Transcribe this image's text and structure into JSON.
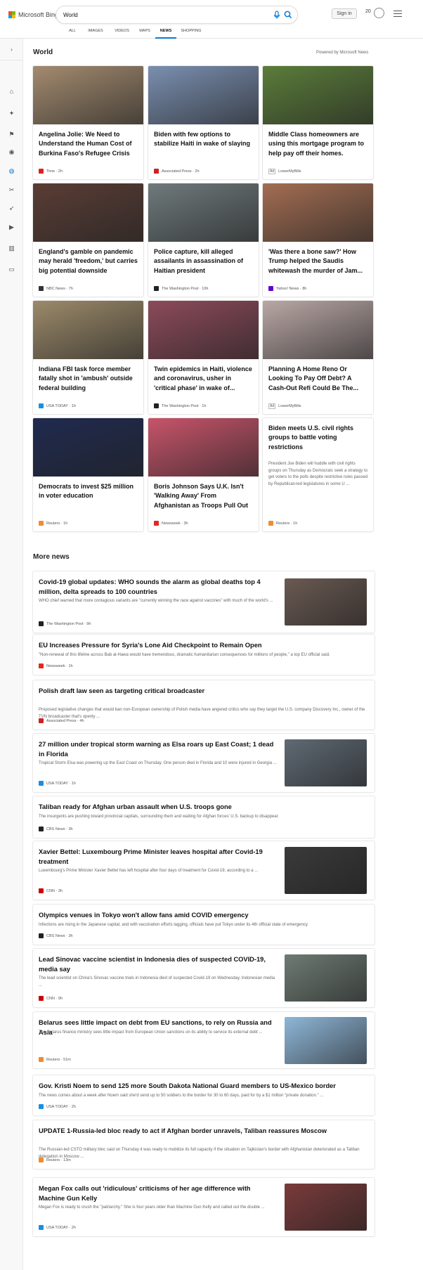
{
  "header": {
    "logo_text": "Microsoft Bing",
    "search_value": "World",
    "sign_in": "Sign in",
    "rewards_points": "20"
  },
  "tabs": [
    "ALL",
    "IMAGES",
    "VIDEOS",
    "MAPS",
    "NEWS",
    "SHOPPING"
  ],
  "active_tab": "NEWS",
  "sidebar_icons": [
    "chevron-right-icon",
    "home-icon",
    "sparkle-icon",
    "flag-icon",
    "location-icon",
    "globe-icon",
    "science-icon",
    "rocket-icon",
    "video-icon",
    "building-icon",
    "card-icon"
  ],
  "world": {
    "title": "World",
    "powered_by": "Powered by Microsoft News",
    "cards": [
      {
        "title": "Angelina Jolie: We Need to Understand the Human Cost of Burkina Faso's Refugee Crisis",
        "source": "Time",
        "age": "2h",
        "ad": "",
        "snippet": "",
        "image_color": "#a38b6f"
      },
      {
        "title": "Biden with few options to stabilize Haiti in wake of slaying",
        "source": "Associated Press",
        "age": "2h",
        "ad": "",
        "snippet": "",
        "image_color": "#7a8fb0"
      },
      {
        "title": "Middle Class homeowners are using this mortgage program to help pay off their homes.",
        "source": "LowerMyBills",
        "age": "",
        "ad": "Ad",
        "snippet": "",
        "image_color": "#5b7d3a"
      },
      {
        "title": "England's gamble on pandemic may herald 'freedom,' but carries big potential downside",
        "source": "NBC News",
        "age": "7h",
        "ad": "",
        "snippet": "",
        "image_color": "#5a3d35"
      },
      {
        "title": "Police capture, kill alleged assailants in assassination of Haitian president",
        "source": "The Washington Post",
        "age": "10h",
        "ad": "",
        "snippet": "",
        "image_color": "#6f7a7c"
      },
      {
        "title": "'Was there a bone saw?' How Trump helped the Saudis whitewash the murder of Jam...",
        "source": "Yahoo! News",
        "age": "8h",
        "ad": "",
        "snippet": "",
        "image_color": "#a36d52"
      },
      {
        "title": "Indiana FBI task force member fatally shot in 'ambush' outside federal building",
        "source": "USA TODAY",
        "age": "1h",
        "ad": "",
        "snippet": "",
        "image_color": "#9c8a6a"
      },
      {
        "title": "Twin epidemics in Haiti, violence and coronavirus, usher in 'critical phase' in wake of...",
        "source": "The Washington Post",
        "age": "1h",
        "ad": "",
        "snippet": "",
        "image_color": "#8c4a5a"
      },
      {
        "title": "Planning A Home Reno Or Looking To Pay Off Debt? A Cash-Out Refi Could Be The...",
        "source": "LowerMyBills",
        "age": "",
        "ad": "Ad",
        "snippet": "",
        "image_color": "#b9a7a5"
      },
      {
        "title": "Democrats to invest $25 million in voter education",
        "source": "Reuters",
        "age": "1h",
        "ad": "",
        "snippet": "",
        "image_color": "#1f2a4f"
      },
      {
        "title": "Boris Johnson Says U.K. Isn't 'Walking Away' From Afghanistan as Troops Pull Out",
        "source": "Newsweek",
        "age": "3h",
        "ad": "",
        "snippet": "",
        "image_color": "#c7546a"
      },
      {
        "title": "Biden meets U.S. civil rights groups to battle voting restrictions",
        "source": "Reuters",
        "age": "1h",
        "ad": "",
        "snippet": "President Joe Biden will huddle with civil rights groups on Thursday as Democrats seek a strategy to get voters to the polls despite restrictive rules passed by Republican-led legislatures in some U ...",
        "image_color": ""
      }
    ]
  },
  "more_news": {
    "title": "More news",
    "items": [
      {
        "title": "Covid-19 global updates: WHO sounds the alarm as global deaths top 4 million, delta spreads to 100 countries",
        "snippet": "WHO chief warned that more contagious variants are \"currently winning the race against vaccines\" with much of the world's ...",
        "source": "The Washington Post",
        "age": "9h",
        "image_color": "#6a5a52"
      },
      {
        "title": "EU Increases Pressure for Syria's Lone Aid Checkpoint to Remain Open",
        "snippet": "\"Non-renewal of this lifeline across Bab al-Hawa would have tremendous, dramatic humanitarian consequences for millions of people,\" a top EU official said.",
        "source": "Newsweek",
        "age": "1h",
        "image_color": ""
      },
      {
        "title": "Polish draft law seen as targeting critical broadcaster",
        "snippet": "Proposed legislative changes that would ban non-European ownership of Polish media have angered critics who say they target the U.S. company Discovery Inc., owner of the TVN broadcaster that's openly ...",
        "source": "Associated Press",
        "age": "4h",
        "image_color": ""
      },
      {
        "title": "27 million under tropical storm warning as Elsa roars up East Coast; 1 dead in Florida",
        "snippet": "Tropical Storm Elsa was powering up the East Coast on Thursday. One person died in Florida and 10 were injured in Georgia ...",
        "source": "USA TODAY",
        "age": "1h",
        "image_color": "#5f6a74"
      },
      {
        "title": "Taliban ready for Afghan urban assault when U.S. troops gone",
        "snippet": "The insurgents are pushing toward provincial capitals, surrounding them and waiting for Afghan forces' U.S. backup to disappear.",
        "source": "CBS News",
        "age": "3h",
        "image_color": ""
      },
      {
        "title": "Xavier Bettel: Luxembourg Prime Minister leaves hospital after Covid-19 treatment",
        "snippet": "Luxembourg's Prime Minister Xavier Bettel has left hospital after four days of treatment for Covid-19, according to a ...",
        "source": "CNN",
        "age": "3h",
        "image_color": "#3b3a3a"
      },
      {
        "title": "Olympics venues in Tokyo won't allow fans amid COVID emergency",
        "snippet": "Infections are rising in the Japanese capital, and with vaccination efforts lagging, officials have put Tokyo under its 4th official state of emergency.",
        "source": "CBS News",
        "age": "3h",
        "image_color": ""
      },
      {
        "title": "Lead Sinovac vaccine scientist in Indonesia dies of suspected COVID-19, media say",
        "snippet": "The lead scientist on China's Sinovac vaccine trials in Indonesia died of suspected Covid-19 on Wednesday, Indonesian media ...",
        "source": "CNN",
        "age": "9h",
        "image_color": "#6e7b74"
      },
      {
        "title": "Belarus sees little impact on debt from EU sanctions, to rely on Russia and Asia",
        "snippet": "The Belarus finance ministry sees little impact from European Union sanctions on its ability to service its external debt ...",
        "source": "Reuters",
        "age": "51m",
        "image_color": "#8fb7d8"
      },
      {
        "title": "Gov. Kristi Noem to send 125 more South Dakota National Guard members to US-Mexico border",
        "snippet": "The news comes about a week after Noem said she'd send up to 50 soldiers to the border for 30 to 60 days, paid for by a $1 million \"private donation.\" ...",
        "source": "USA TODAY",
        "age": "2h",
        "image_color": ""
      },
      {
        "title": "UPDATE 1-Russia-led bloc ready to act if Afghan border unravels, Taliban reassures Moscow",
        "snippet": "The Russian-led CSTO military bloc said on Thursday it was ready to mobilize its full capacity if the situation on Tajikistan's border with Afghanistan deteriorated as a Taliban delegation in Moscow ...",
        "source": "Reuters",
        "age": "13m",
        "image_color": ""
      },
      {
        "title": "Megan Fox calls out 'ridiculous' criticisms of her age difference with Machine Gun Kelly",
        "snippet": "Megan Fox is ready to crush the \"patriarchy.\" She is four years older than Machine Gun Kelly and called out the double ...",
        "source": "USA TODAY",
        "age": "2h",
        "image_color": "#7a3b3b"
      }
    ]
  },
  "source_colors": {
    "Time": "#e02020",
    "Associated Press": "#c22",
    "LowerMyBills": "#888",
    "NBC News": "#333",
    "The Washington Post": "#222",
    "Yahoo! News": "#6001d2",
    "USA TODAY": "#1a8fe0",
    "Reuters": "#f08c30",
    "Newsweek": "#e3281e",
    "CBS News": "#222",
    "CNN": "#cc0000"
  },
  "accent": "#0a7bd4"
}
